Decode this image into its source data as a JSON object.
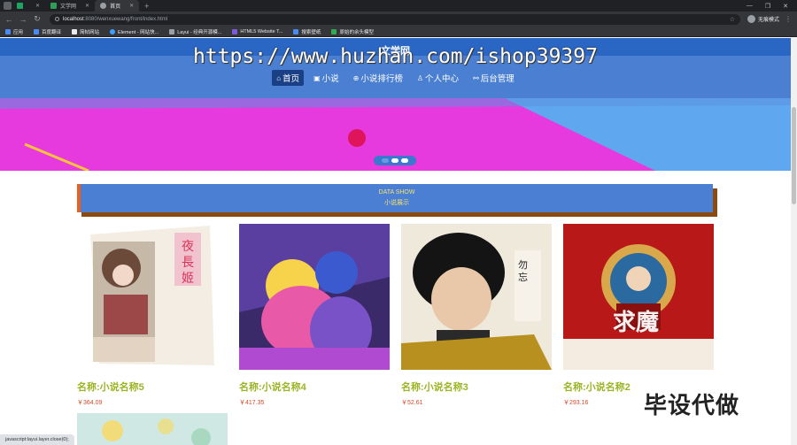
{
  "browser": {
    "tabs": [
      {
        "title": "",
        "active": false
      },
      {
        "title": "文学网",
        "active": false
      },
      {
        "title": "首页",
        "active": true
      }
    ],
    "url_host": "localhost",
    "url_path": ":8080/wenxuewang/front/index.html",
    "profile_label": "无痕模式",
    "bookmarks": [
      "应用",
      "百度翻译",
      "简帖网站",
      "Element - 网站快...",
      "Layui - 经典开源模...",
      "HTML5 Website T...",
      "搜索壁纸",
      "原始的余头模型"
    ],
    "status_text": "javascript:layui.layer.close(0);"
  },
  "site": {
    "title": "文学网",
    "watermark": "https://www.huzhan.com/ishop39397",
    "nav": [
      {
        "label": "首页",
        "icon": "home-icon",
        "active": true
      },
      {
        "label": "小说",
        "icon": "book-icon",
        "active": false
      },
      {
        "label": "小说排行榜",
        "icon": "rank-icon",
        "active": false
      },
      {
        "label": "个人中心",
        "icon": "user-icon",
        "active": false
      },
      {
        "label": "后台管理",
        "icon": "link-icon",
        "active": false
      }
    ]
  },
  "section": {
    "subtitle_en": "DATA SHOW",
    "title_cn": "小说展示"
  },
  "products": [
    {
      "name": "名称:小说名称5",
      "price": "￥364.09"
    },
    {
      "name": "名称:小说名称4",
      "price": "￥417.35"
    },
    {
      "name": "名称:小说名称3",
      "price": "￥52.61"
    },
    {
      "name": "名称:小说名称2",
      "price": "￥293.16"
    }
  ],
  "corner_overlay": "毕设代做",
  "colors": {
    "header_blue": "#4a7fd2",
    "banner_magenta": "#e63adf",
    "banner_lightblue": "#5fa8f0",
    "name_green": "#9bb423",
    "price_red": "#d54a2a",
    "section_text": "#f3e26a"
  }
}
